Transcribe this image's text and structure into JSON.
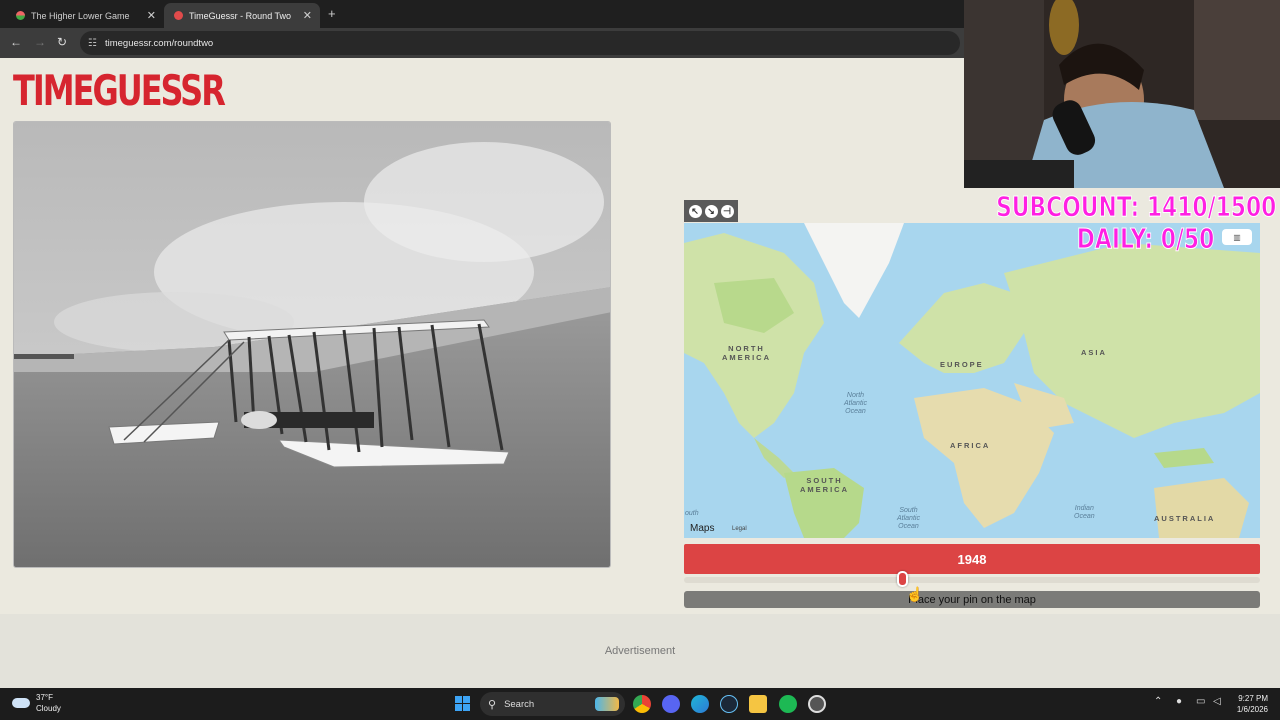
{
  "browser": {
    "tabs": [
      {
        "title": "The Higher Lower Game",
        "active": false
      },
      {
        "title": "TimeGuessr - Round Two",
        "active": true
      }
    ],
    "new_tab_icon": "plus-icon",
    "url": "timeguessr.com/roundtwo"
  },
  "site": {
    "logo": "TIMEGUESSR"
  },
  "map": {
    "labels": {
      "north_america": "NORTH\nAMERICA",
      "europe": "EUROPE",
      "asia": "ASIA",
      "africa": "AFRICA",
      "south_america": "SOUTH\nAMERICA",
      "australia": "AUSTRALIA",
      "north_atlantic": "North\nAtlantic\nOcean",
      "south_atlantic": "South\nAtlantic\nOcean",
      "indian_ocean": "Indian\nOcean",
      "south_partial": "outh"
    },
    "brand": "Maps",
    "legal": "Legal"
  },
  "guess": {
    "year": "1948",
    "slider_fraction": 0.38,
    "place_pin_text": "Place your pin on the map"
  },
  "ad": {
    "label": "Advertisement"
  },
  "stream_overlay": {
    "subcount": "SUBCOUNT: 1410/1500",
    "daily": "DAILY: 0/50",
    "text_color": "#ff1fe3"
  },
  "taskbar": {
    "weather_temp": "37°F",
    "weather_desc": "Cloudy",
    "search_label": "Search",
    "time": "9:27 PM",
    "date": "1/6/2026"
  },
  "colors": {
    "brand_red": "#d6252f",
    "year_bar": "#dc4444",
    "page_bg": "#ebe9df"
  }
}
